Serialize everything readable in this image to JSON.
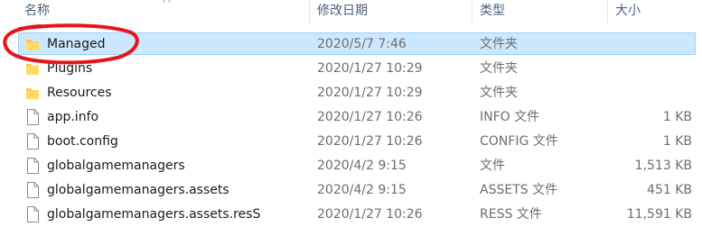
{
  "header": {
    "name": "名称",
    "date_modified": "修改日期",
    "type": "类型",
    "size": "大小"
  },
  "files": [
    {
      "name": "Managed",
      "date": "2020/5/7 7:46",
      "type": "文件夹",
      "size": "",
      "icon": "folder-icon",
      "selected": true
    },
    {
      "name": "Plugins",
      "date": "2020/1/27 10:29",
      "type": "文件夹",
      "size": "",
      "icon": "folder-icon"
    },
    {
      "name": "Resources",
      "date": "2020/1/27 10:29",
      "type": "文件夹",
      "size": "",
      "icon": "folder-icon"
    },
    {
      "name": "app.info",
      "date": "2020/1/27 10:26",
      "type": "INFO 文件",
      "size": "1 KB",
      "icon": "file-icon"
    },
    {
      "name": "boot.config",
      "date": "2020/1/27 10:26",
      "type": "CONFIG 文件",
      "size": "1 KB",
      "icon": "file-icon"
    },
    {
      "name": "globalgamemanagers",
      "date": "2020/4/2 9:15",
      "type": "文件",
      "size": "1,513 KB",
      "icon": "file-icon"
    },
    {
      "name": "globalgamemanagers.assets",
      "date": "2020/4/2 9:15",
      "type": "ASSETS 文件",
      "size": "451 KB",
      "icon": "file-icon"
    },
    {
      "name": "globalgamemanagers.assets.resS",
      "date": "2020/1/27 10:26",
      "type": "RESS 文件",
      "size": "11,591 KB",
      "icon": "file-icon"
    }
  ],
  "colors": {
    "selection": "#cce8ff",
    "selection_border": "#99d1ff",
    "folder": "#ffc83d",
    "annotation": "#e8141b"
  }
}
